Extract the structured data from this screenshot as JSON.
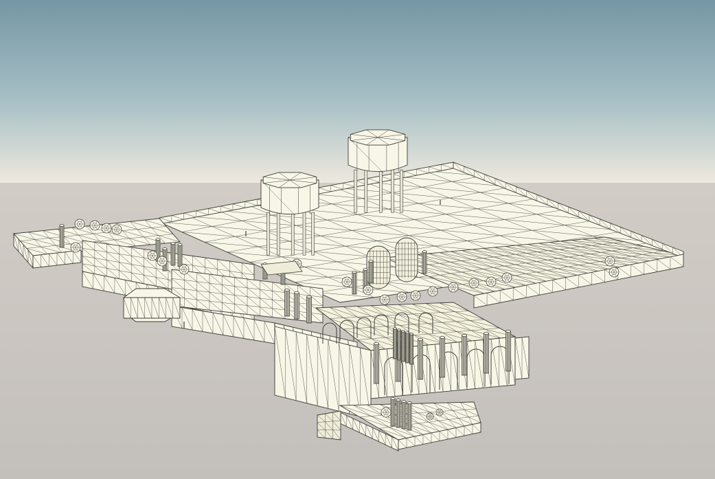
{
  "scene": {
    "colors": {
      "sky_top": "#7596a4",
      "sky_mid": "#a7c0c6",
      "horizon": "#efe9df",
      "ground_top": "#d2ccc6",
      "ground_bottom": "#c3bfbb",
      "mesh_fill": "#f8f6e7",
      "mesh_fill_shade": "#efecd8",
      "wire": "#3c3c38"
    },
    "render_mode": "wireframe-shaded"
  }
}
